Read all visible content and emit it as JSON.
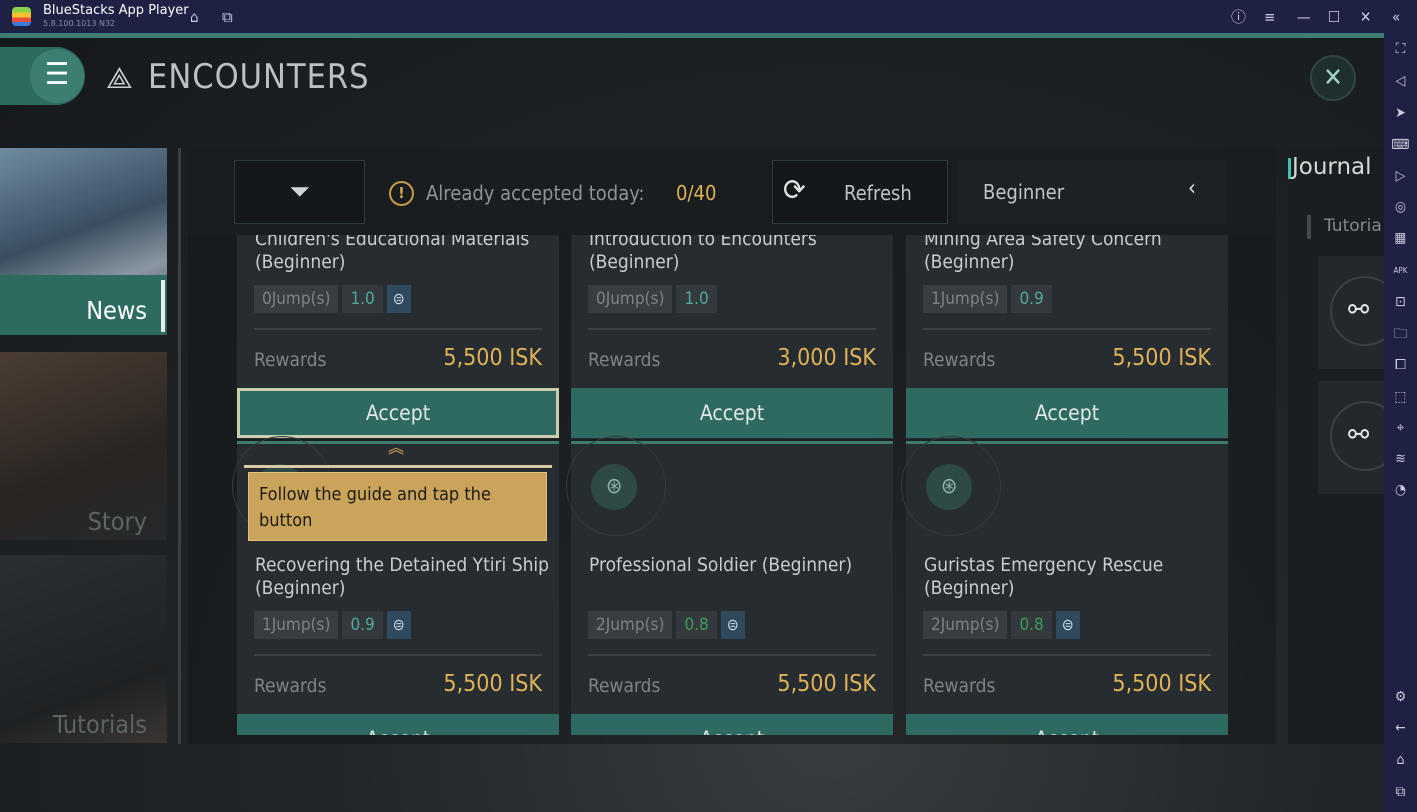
{
  "window": {
    "title": "BlueStacks App Player",
    "version": "5.8.100.1013  N32"
  },
  "header": {
    "title": "ENCOUNTERS"
  },
  "sidebar": {
    "items": [
      {
        "label": "News",
        "active": true
      },
      {
        "label": "Story"
      },
      {
        "label": "Tutorials"
      }
    ]
  },
  "toolbar": {
    "accepted_label": "Already accepted today:",
    "accepted_value": "0/40",
    "refresh_label": "Refresh",
    "difficulty": "Beginner"
  },
  "journal": {
    "title": "Journal",
    "tab": "Tutoria"
  },
  "tooltip": {
    "text": "Follow the guide and tap the button"
  },
  "cards": [
    {
      "title": "Children's Educational Materials (Beginner)",
      "jumps": "0Jump(s)",
      "security": "1.0",
      "has_icon": true,
      "rewards_label": "Rewards",
      "reward": "5,500 ISK",
      "accept": "Accept",
      "highlighted": true
    },
    {
      "title": "Introduction to Encounters (Beginner)",
      "jumps": "0Jump(s)",
      "security": "1.0",
      "has_icon": false,
      "rewards_label": "Rewards",
      "reward": "3,000 ISK",
      "accept": "Accept"
    },
    {
      "title": "Mining Area Safety Concern (Beginner)",
      "jumps": "1Jump(s)",
      "security": "0.9",
      "has_icon": false,
      "rewards_label": "Rewards",
      "reward": "5,500 ISK",
      "accept": "Accept"
    },
    {
      "title": "Recovering the Detained Ytiri Ship (Beginner)",
      "jumps": "1Jump(s)",
      "security": "0.9",
      "has_icon": true,
      "rewards_label": "Rewards",
      "reward": "5,500 ISK",
      "accept": "Accept"
    },
    {
      "title": "Professional Soldier (Beginner)",
      "jumps": "2Jump(s)",
      "security": "0.8",
      "has_icon": true,
      "rewards_label": "Rewards",
      "reward": "5,500 ISK",
      "accept": "Accept"
    },
    {
      "title": "Guristas Emergency Rescue (Beginner)",
      "jumps": "2Jump(s)",
      "security": "0.8",
      "has_icon": true,
      "rewards_label": "Rewards",
      "reward": "5,500 ISK",
      "accept": "Accept"
    }
  ],
  "colors": {
    "accent": "#3f7c70",
    "reward": "#e0b257",
    "titlebar": "#1e2044",
    "tooltip": "#c9a45a"
  }
}
